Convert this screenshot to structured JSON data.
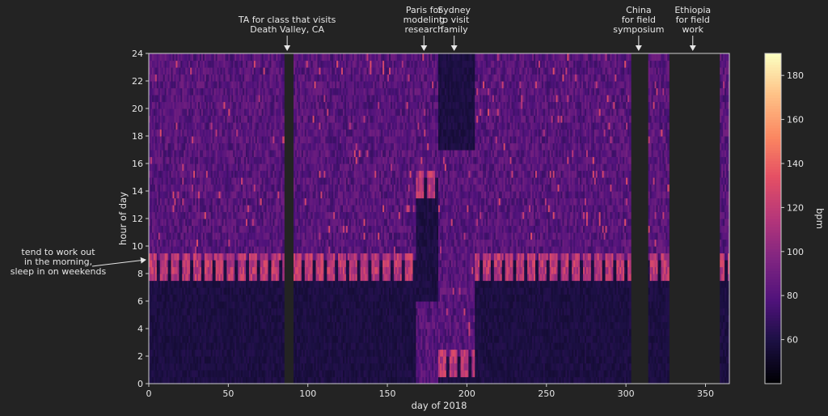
{
  "chart_data": {
    "type": "heatmap",
    "title": "",
    "xlabel": "day of 2018",
    "ylabel": "hour of day",
    "colorbar_label": "bpm",
    "colormap": "magma",
    "background": "#232323",
    "x_range": [
      0,
      365
    ],
    "y_range": [
      0,
      24
    ],
    "x_ticks": [
      0,
      50,
      100,
      150,
      200,
      250,
      300,
      350
    ],
    "y_ticks": [
      0,
      2,
      4,
      6,
      8,
      10,
      12,
      14,
      16,
      18,
      20,
      22,
      24
    ],
    "color_range": [
      40,
      190
    ],
    "colorbar_ticks": [
      60,
      80,
      100,
      120,
      140,
      160,
      180
    ],
    "missing_day_ranges": [
      [
        85,
        91
      ],
      [
        303,
        314
      ],
      [
        327,
        359
      ]
    ],
    "typical_values": {
      "sleep_bpm": 55,
      "day_bpm": 82,
      "morning_workout_bpm": 112,
      "wake_hour_weekday": 8,
      "wake_hour_weekend": 9.5
    },
    "annotations": [
      {
        "lines": [
          "TA for class that visits",
          "Death Valley, CA"
        ],
        "arrow_day": 87
      },
      {
        "lines": [
          "Paris for",
          "modeling",
          "research"
        ],
        "arrow_day": 173
      },
      {
        "lines": [
          "Sydney",
          "to visit",
          "family"
        ],
        "arrow_day": 192
      },
      {
        "lines": [
          "China",
          "for field",
          "symposium"
        ],
        "arrow_day": 308
      },
      {
        "lines": [
          "Ethiopia",
          "for field",
          "work"
        ],
        "arrow_day": 342
      },
      {
        "lines": [
          "tend to work out",
          "in the morning,",
          "sleep in on weekends"
        ],
        "arrow_day": 0,
        "arrow_hour": 9
      }
    ]
  }
}
